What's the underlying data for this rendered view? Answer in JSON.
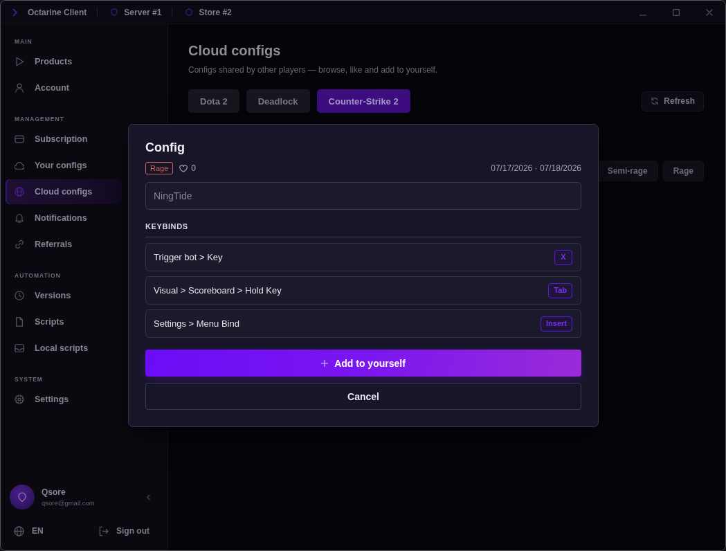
{
  "window": {
    "title": "Octarine Client",
    "badges": [
      {
        "kind": "server",
        "label": "Server #1"
      },
      {
        "kind": "store",
        "label": "Store #2"
      }
    ]
  },
  "sidebar": {
    "sections": [
      {
        "title": "MAIN",
        "items": [
          {
            "kind": "products",
            "label": "Products",
            "selected": false
          },
          {
            "kind": "account",
            "label": "Account",
            "selected": false
          }
        ]
      },
      {
        "title": "MANAGEMENT",
        "items": [
          {
            "kind": "subscription",
            "label": "Subscription",
            "selected": false
          },
          {
            "kind": "configs",
            "label": "Your configs",
            "selected": false
          },
          {
            "kind": "cloud",
            "label": "Cloud configs",
            "selected": true
          },
          {
            "kind": "notifications",
            "label": "Notifications",
            "selected": false
          },
          {
            "kind": "referrals",
            "label": "Referrals",
            "selected": false
          }
        ]
      },
      {
        "title": "AUTOMATION",
        "items": [
          {
            "kind": "versions",
            "label": "Versions",
            "selected": false
          },
          {
            "kind": "scripts",
            "label": "Scripts",
            "selected": false
          },
          {
            "kind": "local",
            "label": "Local scripts",
            "selected": false
          }
        ]
      },
      {
        "title": "SYSTEM",
        "items": [
          {
            "kind": "settings",
            "label": "Settings",
            "selected": false
          }
        ]
      }
    ],
    "user": {
      "name": "Qsore",
      "email": "qsore@gmail.com"
    },
    "language": "EN",
    "sign_out": "Sign out"
  },
  "page": {
    "title": "Cloud configs",
    "subtitle": "Configs shared by other players — browse, like and add to yourself.",
    "game_tabs": [
      {
        "label": "Dota 2",
        "selected": false
      },
      {
        "label": "Deadlock",
        "selected": false
      },
      {
        "label": "Counter-Strike 2",
        "selected": true
      }
    ],
    "refresh": "Refresh",
    "filters": [
      {
        "label": "Semi-rage",
        "selected": false
      },
      {
        "label": "Rage",
        "selected": false
      }
    ]
  },
  "dialog": {
    "title": "Config",
    "tag": {
      "label": "Rage",
      "color": "#d0605a"
    },
    "liked": false,
    "likes": "0",
    "dates": "07/17/2026 · 07/18/2026",
    "name_field": {
      "value": "NingTide"
    },
    "keybinds_title": "KEYBINDS",
    "keybinds": [
      {
        "action": "Trigger bot > Key",
        "key": "X"
      },
      {
        "action": "Visual > Scoreboard > Hold Key",
        "key": "Tab"
      },
      {
        "action": "Settings > Menu Bind",
        "key": "Insert"
      }
    ],
    "add_button": "Add to yourself",
    "cancel_button": "Cancel"
  }
}
